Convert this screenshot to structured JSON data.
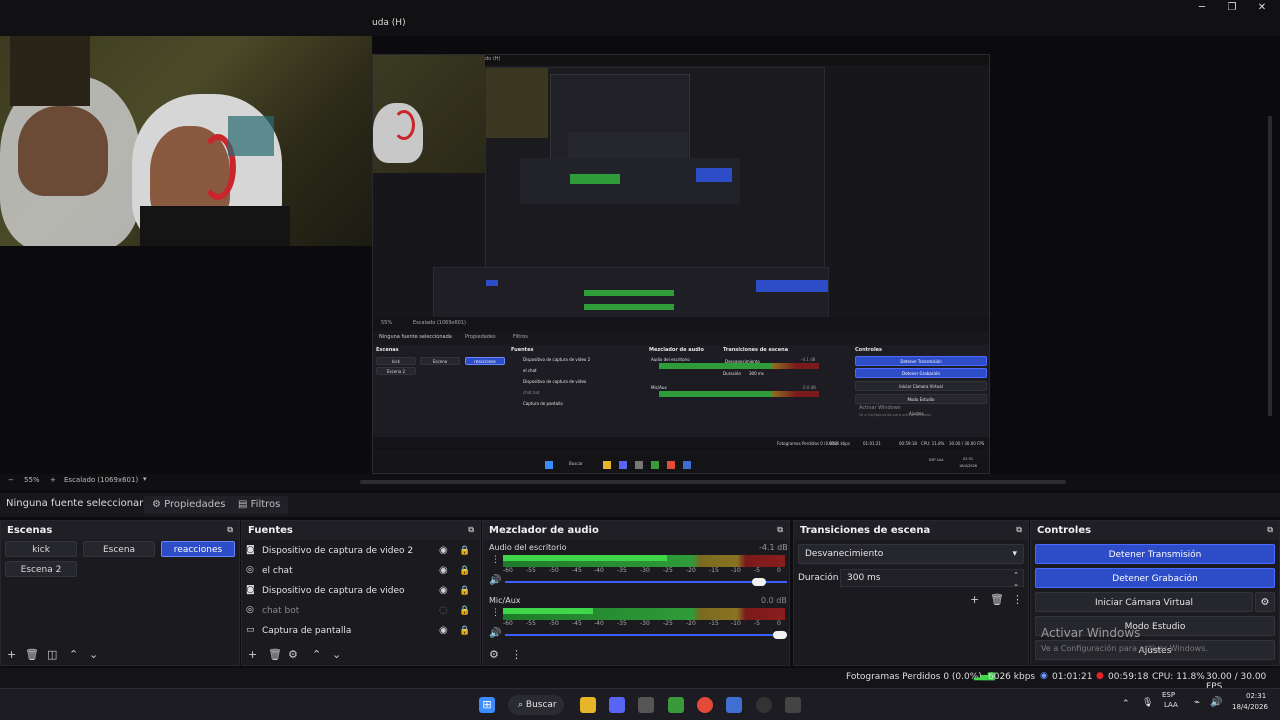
{
  "window": {
    "menu_fragment": "uda (H)",
    "controls": [
      "─",
      "❐",
      "✕"
    ]
  },
  "preview": {
    "nested_title": "do (H)",
    "nested_bar_left": "Ninguna fuente seleccionada",
    "nested_bar_props": "Propiedades",
    "nested_bar_filters": "Filtros",
    "nested_zoom": "55%",
    "nested_scale": "Escalado (1069x601)",
    "nested_scenes": "Escenas",
    "nested_sources": "Fuentes",
    "nested_mixer": "Mezclador de audio",
    "nested_transitions": "Transiciones de escena",
    "nested_controls": "Controles",
    "nested_scene_buttons": [
      "kick",
      "Escena",
      "reacciones",
      "Escena 2"
    ],
    "nested_sources_list": [
      "Dispositivo de captura de video 2",
      "el chat",
      "Dispositivo de captura de video",
      "chat bot",
      "Captura de pantalla"
    ],
    "nested_audio1": "Audio del escritorio",
    "nested_audio1_db": "-4.1 dB",
    "nested_audio2": "Mic/Aux",
    "nested_audio2_db": "0.0 dB",
    "nested_transition": "Desvanecimiento",
    "nested_duration_label": "Duración",
    "nested_duration": "300 ms",
    "nested_btn_stream": "Detener Transmisión",
    "nested_btn_record": "Detener Grabación",
    "nested_btn_vcam": "Iniciar Cámara Virtual",
    "nested_btn_studio": "Modo Estudio",
    "nested_btn_settings": "Ajustes",
    "nested_wm1": "Activar Windows",
    "nested_wm2": "Ve a Configuración para activar Windows.",
    "nested_status": "Fotogramas Perdidos 0 (0.0%)",
    "nested_kbps": "6026 kbps",
    "nested_time1": "01:01:21",
    "nested_time2": "00:59:18",
    "nested_cpu": "CPU: 11.8%",
    "nested_fps": "30.00 / 30.00 FPS",
    "nested_search": "Buscar",
    "nested_lang": "ESP LAA",
    "nested_clock": "02:31",
    "nested_date": "18/4/2026"
  },
  "zoom": {
    "minus": "−",
    "value": "55%",
    "plus": "+",
    "scale": "Escalado (1069x601)"
  },
  "sourcebar": {
    "none_selected": "Ninguna fuente seleccionar",
    "properties": "Propiedades",
    "filters": "Filtros"
  },
  "scenes": {
    "title": "Escenas",
    "buttons": [
      "kick",
      "Escena",
      "reacciones",
      "Escena 2"
    ]
  },
  "sources": {
    "title": "Fuentes",
    "items": [
      {
        "label": "Dispositivo de captura de video 2",
        "icon": "camera-icon",
        "glyph": "◙"
      },
      {
        "label": "el chat",
        "icon": "browser-icon",
        "glyph": "◎"
      },
      {
        "label": "Dispositivo de captura de video",
        "icon": "camera-icon",
        "glyph": "◙"
      },
      {
        "label": "chat bot",
        "icon": "browser-icon",
        "glyph": "◎"
      },
      {
        "label": "Captura de pantalla",
        "icon": "monitor-icon",
        "glyph": "▭"
      }
    ]
  },
  "mixer": {
    "title": "Mezclador de audio",
    "channel1": {
      "name": "Audio del escritorio",
      "db": "-4.1 dB",
      "level": 0.58,
      "volume": 0.92
    },
    "channel2": {
      "name": "Mic/Aux",
      "db": "0.0 dB",
      "level": 0.32,
      "volume": 1.0
    },
    "ticks": [
      "-60",
      "-55",
      "-50",
      "-45",
      "-40",
      "-35",
      "-30",
      "-25",
      "-20",
      "-15",
      "-10",
      "-5",
      "0"
    ]
  },
  "transitions": {
    "title": "Transiciones de escena",
    "selected": "Desvanecimiento",
    "duration_label": "Duración",
    "duration_value": "300 ms"
  },
  "controls": {
    "title": "Controles",
    "stop_stream": "Detener Transmisión",
    "stop_record": "Detener Grabación",
    "virtual_cam": "Iniciar Cámara Virtual",
    "studio_mode": "Modo Estudio",
    "settings": "Ajustes",
    "watermark1": "Activar Windows",
    "watermark2": "Ve a Configuración para activar Windows."
  },
  "status": {
    "dropped_frames": "Fotogramas Perdidos 0 (0.0%)",
    "bitrate": "6026 kbps",
    "stream_time": "01:01:21",
    "record_time": "00:59:18",
    "cpu": "CPU: 11.8%",
    "fps": "30.00 / 30.00 FPS"
  },
  "taskbar": {
    "search": "Buscar",
    "lang1": "ESP",
    "lang2": "LAA",
    "time": "02:31",
    "date": "18/4/2026"
  },
  "colors": {
    "accent_blue": "#2d4cc8",
    "meter_green": "#3fd64a",
    "record_red": "#e0242b"
  }
}
